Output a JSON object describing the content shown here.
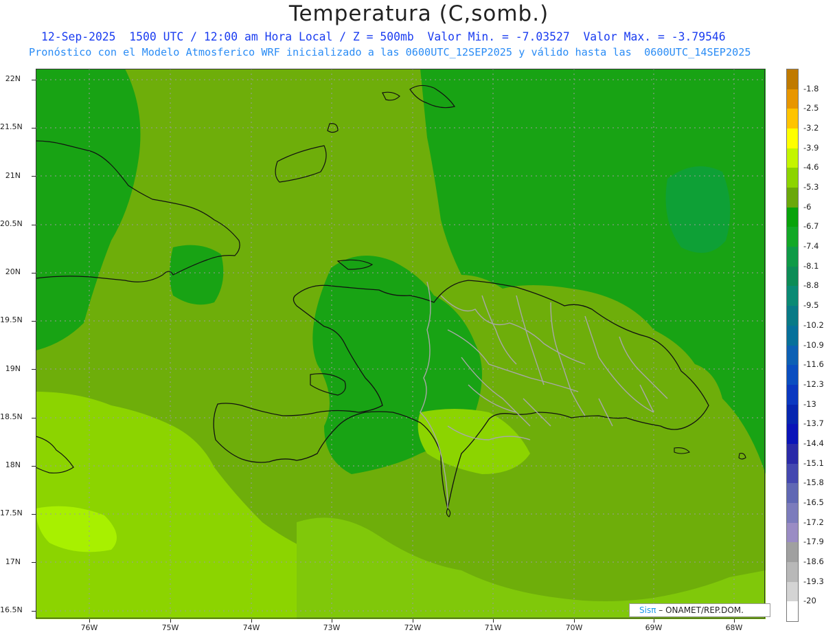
{
  "header": {
    "title": "Temperatura (C,somb.)",
    "subtitle1": "12-Sep-2025  1500 UTC / 12:00 am Hora Local / Z = 500mb  Valor Min. = -7.03527  Valor Max. = -3.79546",
    "subtitle2": "Pronóstico con el Modelo Atmosferico WRF inicializado a las 0600UTC_12SEP2025 y válido hasta las  0600UTC_14SEP2025"
  },
  "axes": {
    "lat_labels": [
      "22N",
      "21.5N",
      "21N",
      "20.5N",
      "20N",
      "19.5N",
      "19N",
      "18.5N",
      "18N",
      "17.5N",
      "17N",
      "16.5N"
    ],
    "lon_labels": [
      "76W",
      "75W",
      "74W",
      "73W",
      "72W",
      "71W",
      "70W",
      "69W",
      "68W"
    ]
  },
  "colorbar": {
    "labels": [
      "-1.8",
      "-2.5",
      "-3.2",
      "-3.9",
      "-4.6",
      "-5.3",
      "-6",
      "-6.7",
      "-7.4",
      "-8.1",
      "-8.8",
      "-9.5",
      "-10.2",
      "-10.9",
      "-11.6",
      "-12.3",
      "-13",
      "-13.7",
      "-14.4",
      "-15.1",
      "-15.8",
      "-16.5",
      "-17.2",
      "-17.9",
      "-18.6",
      "-19.3",
      "-20"
    ],
    "colors": [
      "#c07a00",
      "#e89600",
      "#ffc400",
      "#ffff00",
      "#c4f500",
      "#8cd400",
      "#6aa80a",
      "#08a30a",
      "#12a826",
      "#0e9a46",
      "#0c8c56",
      "#0a8a74",
      "#087a86",
      "#06709a",
      "#0c60b4",
      "#0a4ec0",
      "#0a38c0",
      "#0626b0",
      "#0a14b8",
      "#2a2aa8",
      "#4448b0",
      "#6068b4",
      "#7c7cbc",
      "#9a8cc4",
      "#a0a0a0",
      "#b8b8b8",
      "#d4d4d4",
      "#ffffff"
    ]
  },
  "map_colors": {
    "ocean_mid": "#6eae0a",
    "cool_green": "#18a314",
    "warm_lime": "#8cd400",
    "hot_lime": "#a8f000",
    "coast": "#111111",
    "province": "#a8a8a8"
  },
  "credit": {
    "sis": "Sis",
    "pi": "π",
    "text": " – ONAMET/REP.DOM."
  }
}
